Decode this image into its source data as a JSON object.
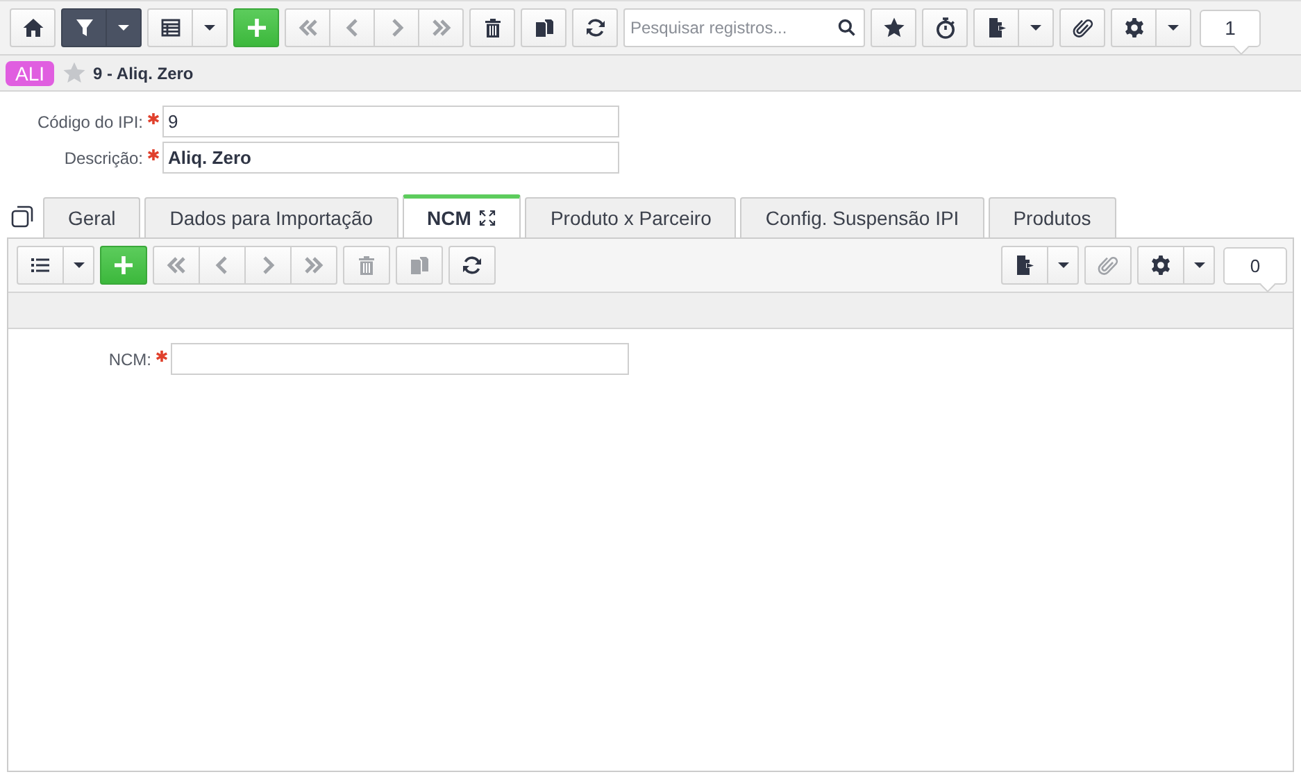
{
  "toolbar": {
    "left": [
      {
        "buttons": [
          {
            "kind": "home",
            "disabled": false
          }
        ]
      },
      {
        "active": true,
        "buttons": [
          {
            "kind": "filter",
            "disabled": false
          },
          {
            "kind": "caret",
            "disabled": false
          }
        ]
      },
      {
        "buttons": [
          {
            "kind": "grid",
            "disabled": false
          },
          {
            "kind": "caret",
            "disabled": false
          }
        ]
      },
      {
        "buttons": [
          {
            "kind": "add",
            "disabled": false
          }
        ]
      },
      {
        "buttons": [
          {
            "kind": "first",
            "disabled": true
          },
          {
            "kind": "prev",
            "disabled": true
          },
          {
            "kind": "next",
            "disabled": true
          },
          {
            "kind": "last",
            "disabled": true
          }
        ]
      },
      {
        "buttons": [
          {
            "kind": "delete",
            "disabled": false
          }
        ]
      },
      {
        "buttons": [
          {
            "kind": "copy",
            "disabled": false
          }
        ]
      },
      {
        "buttons": [
          {
            "kind": "refresh",
            "disabled": false
          }
        ]
      }
    ],
    "search": {
      "placeholder": "Pesquisar registros..."
    },
    "right": [
      {
        "buttons": [
          {
            "kind": "favorite",
            "disabled": false
          }
        ]
      },
      {
        "buttons": [
          {
            "kind": "timer",
            "disabled": false
          }
        ]
      },
      {
        "buttons": [
          {
            "kind": "export",
            "disabled": false
          },
          {
            "kind": "caret",
            "disabled": false
          }
        ]
      },
      {
        "buttons": [
          {
            "kind": "attach",
            "disabled": false
          }
        ]
      },
      {
        "buttons": [
          {
            "kind": "settings",
            "disabled": false
          },
          {
            "kind": "caret",
            "disabled": false
          }
        ]
      }
    ],
    "count": "1"
  },
  "record": {
    "badge": "ALI",
    "favorite": false,
    "title": "9 - Aliq. Zero"
  },
  "fields": [
    {
      "label": "Código do IPI:",
      "required": true,
      "value": "9",
      "bold": false
    },
    {
      "label": "Descrição:",
      "required": true,
      "value": "Aliq. Zero",
      "bold": true
    }
  ],
  "tabs": [
    {
      "label": "Geral",
      "selected": false,
      "maximize": false
    },
    {
      "label": "Dados para Importação",
      "selected": false,
      "maximize": false
    },
    {
      "label": "NCM",
      "selected": true,
      "maximize": true
    },
    {
      "label": "Produto x Parceiro",
      "selected": false,
      "maximize": false
    },
    {
      "label": "Config. Suspensão IPI",
      "selected": false,
      "maximize": false
    },
    {
      "label": "Produtos",
      "selected": false,
      "maximize": false
    }
  ],
  "subtoolbar": {
    "left": [
      {
        "buttons": [
          {
            "kind": "list",
            "disabled": false
          },
          {
            "kind": "caret",
            "disabled": false
          }
        ]
      },
      {
        "buttons": [
          {
            "kind": "add",
            "disabled": false
          }
        ]
      },
      {
        "buttons": [
          {
            "kind": "first",
            "disabled": true
          },
          {
            "kind": "prev",
            "disabled": true
          },
          {
            "kind": "next",
            "disabled": true
          },
          {
            "kind": "last",
            "disabled": true
          }
        ]
      },
      {
        "buttons": [
          {
            "kind": "delete",
            "disabled": true
          }
        ]
      },
      {
        "buttons": [
          {
            "kind": "copy",
            "disabled": true
          }
        ]
      },
      {
        "buttons": [
          {
            "kind": "refresh",
            "disabled": false
          }
        ]
      }
    ],
    "right": [
      {
        "buttons": [
          {
            "kind": "export",
            "disabled": false
          },
          {
            "kind": "caret",
            "disabled": false
          }
        ]
      },
      {
        "buttons": [
          {
            "kind": "attach",
            "disabled": true
          }
        ]
      },
      {
        "buttons": [
          {
            "kind": "settings",
            "disabled": false
          },
          {
            "kind": "caret",
            "disabled": false
          }
        ]
      }
    ],
    "count": "0"
  },
  "subfields": [
    {
      "label": "NCM:",
      "required": true
    }
  ]
}
